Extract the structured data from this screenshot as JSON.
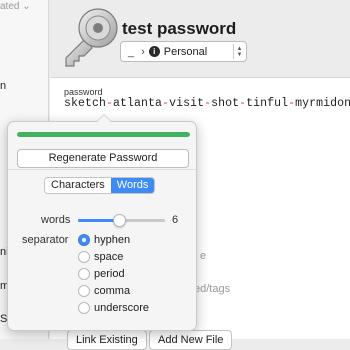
{
  "sidebar": {
    "sort_label": "ated ⌄",
    "fragments": [
      "n",
      "ni",
      "mi",
      "S c"
    ]
  },
  "item": {
    "title": "test password",
    "vault_account": "_",
    "vault_name": "Personal"
  },
  "field": {
    "label": "password",
    "value_parts": [
      "sketch",
      "atlanta",
      "visit",
      "shot",
      "tinful",
      "myrmidon"
    ],
    "separator_char": "-"
  },
  "background": {
    "fragment_e": "e",
    "fragment_tags": "ed/tags",
    "link_existing": "Link Existing",
    "add_new_file": "Add New File"
  },
  "generator": {
    "strength_fraction": 1.0,
    "strength_color": "#41b35f",
    "regenerate_label": "Regenerate Password",
    "tabs": [
      {
        "label": "Characters",
        "active": false
      },
      {
        "label": "Words",
        "active": true
      }
    ],
    "words_label": "words",
    "words_value": "6",
    "words_slider_fraction": 0.47,
    "separator_label": "separator",
    "separators": [
      {
        "label": "hyphen",
        "selected": true
      },
      {
        "label": "space",
        "selected": false
      },
      {
        "label": "period",
        "selected": false
      },
      {
        "label": "comma",
        "selected": false
      },
      {
        "label": "underscore",
        "selected": false
      }
    ],
    "accent_color": "#3d8cf5"
  }
}
